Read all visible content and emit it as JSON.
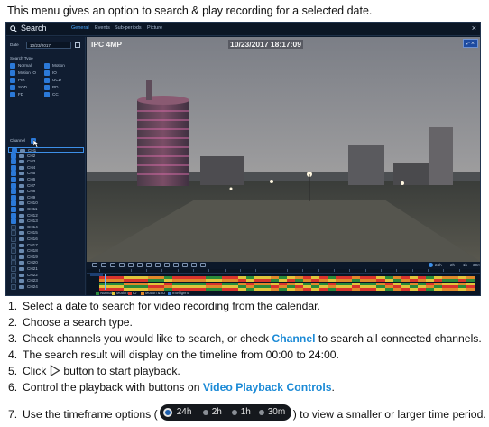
{
  "intro": "This menu gives an option to search & play recording for a selected date.",
  "window": {
    "title": "Search",
    "tabs": [
      "General",
      "Events",
      "Sub-periods",
      "Picture"
    ],
    "active_tab": 0,
    "close": "×"
  },
  "sidebar": {
    "date_label": "Date",
    "date_value": "10/23/2017",
    "search_type_label": "Search Type",
    "search_types": [
      "Normal",
      "Motion",
      "Motion IO",
      "IO",
      "PIR",
      "UCD",
      "SOD",
      "PD",
      "FD",
      "CC"
    ],
    "channel_label": "Channel",
    "channels": [
      "CH1",
      "CH2",
      "CH3",
      "CH4",
      "CH5",
      "CH6",
      "CH7",
      "CH8",
      "CH9",
      "CH10",
      "CH11",
      "CH12",
      "CH13",
      "CH14",
      "CH15",
      "CH16",
      "CH17",
      "CH18",
      "CH19",
      "CH20",
      "CH21",
      "CH22",
      "CH23",
      "CH24"
    ],
    "checked_channels": 13
  },
  "video": {
    "camera": "IPC 4MP",
    "timestamp": "10/23/2017 18:17:09",
    "osd_button": "⤢ ✕"
  },
  "playback_bar": {
    "timeframes": [
      "24h",
      "2h",
      "1h",
      "30m"
    ]
  },
  "timeline": {
    "legend": [
      {
        "label": "Normal",
        "color": "#2a8a3a"
      },
      {
        "label": "Motion",
        "color": "#e0c53a"
      },
      {
        "label": "IO",
        "color": "#d8342c"
      },
      {
        "label": "Motion & IO",
        "color": "#e0882a"
      },
      {
        "label": "Intelligent",
        "color": "#2b79d8"
      }
    ]
  },
  "steps": {
    "s1": {
      "num": "1.",
      "text": "Select a date to search for video recording from the calendar."
    },
    "s2": {
      "num": "2.",
      "text": "Choose a search type."
    },
    "s3": {
      "num": "3.",
      "pre": "Check channels you would like to search, or check ",
      "link": "Channel",
      "post": " to search all connected channels."
    },
    "s4": {
      "num": "4.",
      "text": "The search result will display on the timeline from 00:00 to 24:00."
    },
    "s5": {
      "num": "5.",
      "pre": "Click",
      "post": "button to start playback."
    },
    "s6": {
      "num": "6.",
      "pre": "Control the playback with buttons on ",
      "link": "Video Playback Controls",
      "post": "."
    },
    "s7": {
      "num": "7.",
      "pre": "Use the timeframe options (",
      "post": ") to view a smaller or larger time period."
    }
  },
  "colors": {
    "link": "#1b8ad6",
    "accent": "#2b79d8",
    "window_bg": "#0d1a2c"
  }
}
